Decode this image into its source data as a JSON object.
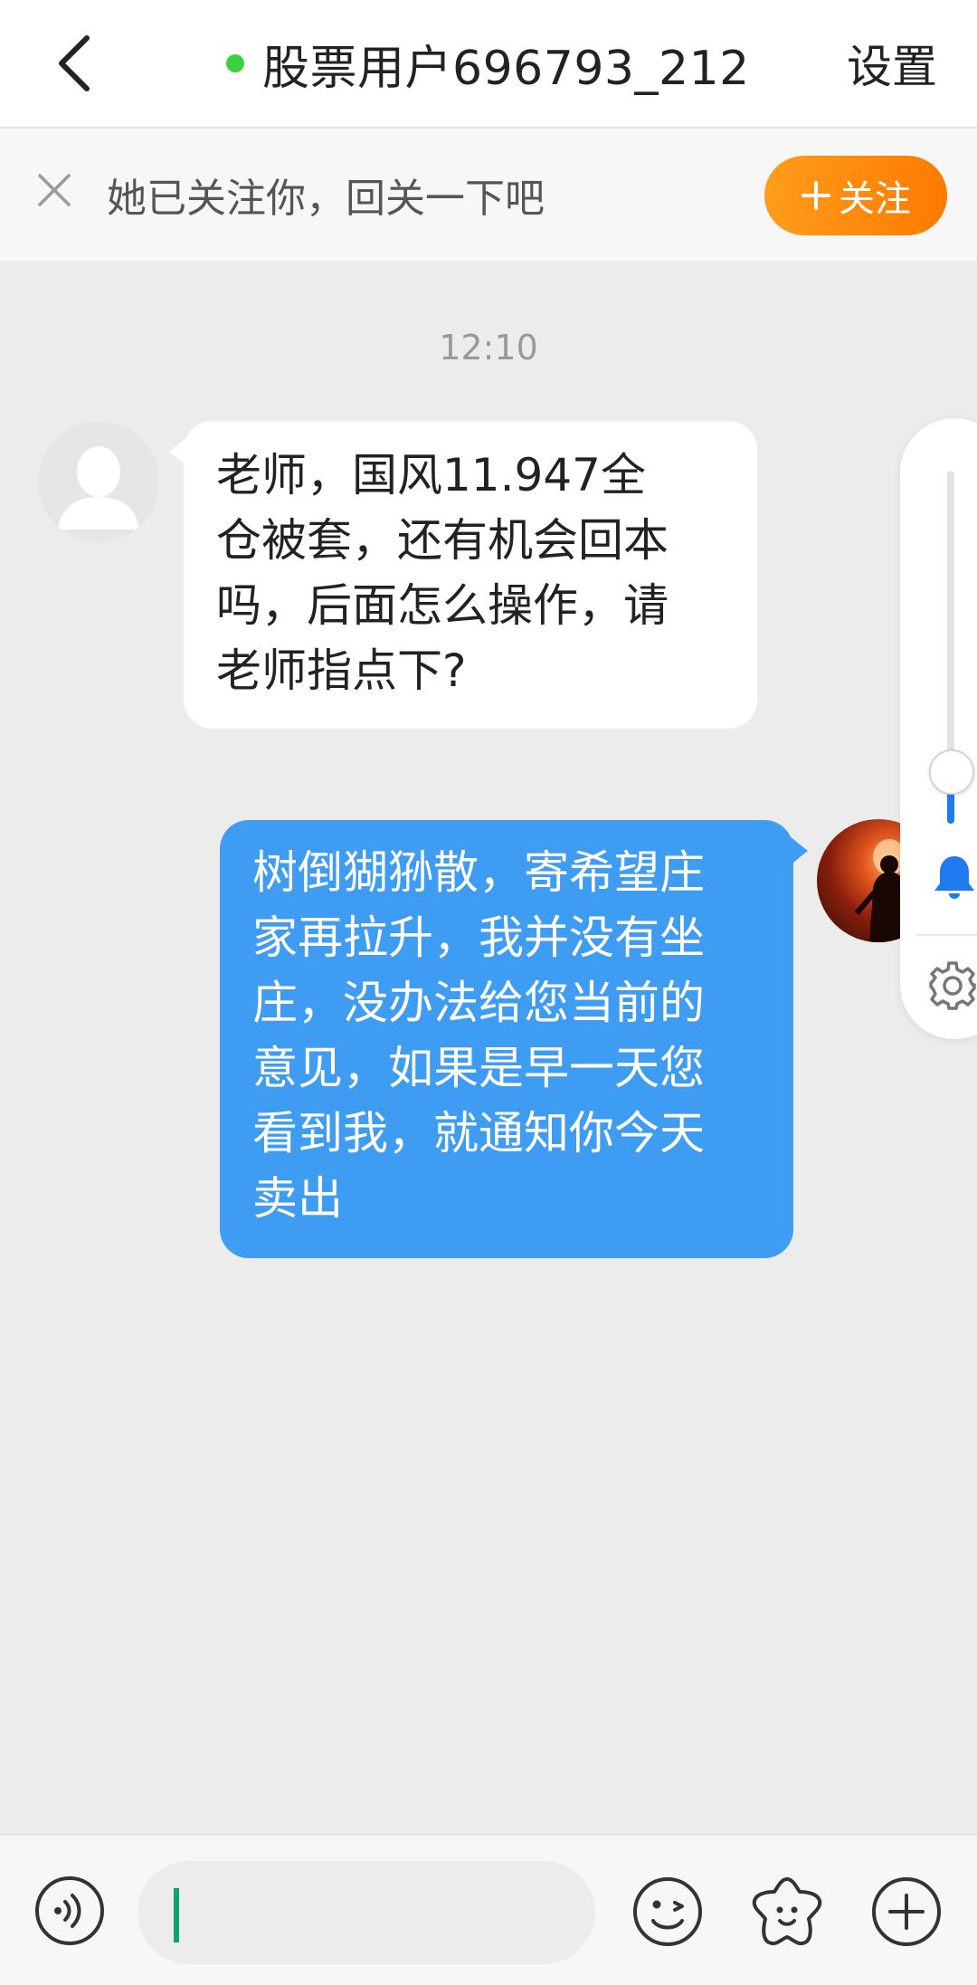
{
  "header": {
    "back_icon": "chevron-left-icon",
    "title": "股票用户696793_212",
    "online_status_color": "#3ecf3e",
    "settings_label": "设置"
  },
  "follow_bar": {
    "close_icon": "close-icon",
    "text": "她已关注你，回关一下吧",
    "button_label": "关注",
    "button_icon": "plus-icon",
    "button_color": "#ff8a00"
  },
  "chat": {
    "time": "12:10",
    "messages": [
      {
        "direction": "incoming",
        "avatar": "default-avatar",
        "text": "老师，国风11.947全\n仓被套，还有机会回本\n吗，后面怎么操作，请\n老师指点下?"
      },
      {
        "direction": "outgoing",
        "avatar": "user-avatar",
        "bubble_color": "#3f9cf3",
        "text": "树倒猢狲散，寄希望庄\n家再拉升，我并没有坐\n庄，没办法给您当前的\n意见，如果是早一天您\n看到我，就通知你今天\n卖出"
      }
    ]
  },
  "side_panel": {
    "slider_level": 0.15,
    "bell_icon": "bell-icon",
    "gear_icon": "gear-icon"
  },
  "bottom_bar": {
    "voice_icon": "voice-icon",
    "input_value": "",
    "emoji_icon": "emoji-icon",
    "sticker_icon": "sticker-icon",
    "plus_icon": "plus-circle-icon"
  }
}
